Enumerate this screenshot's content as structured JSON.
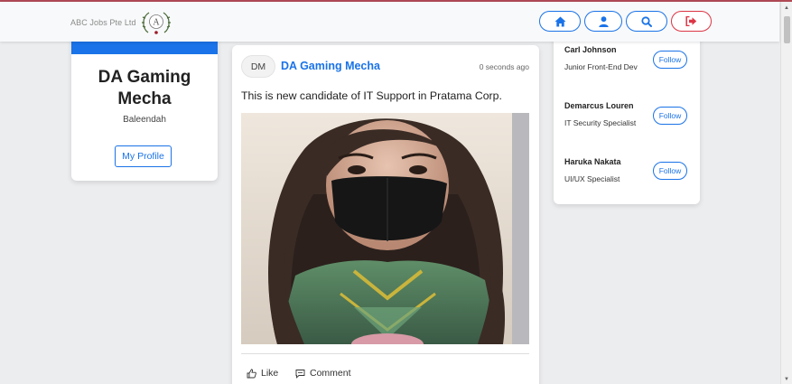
{
  "brand": {
    "name": "ABC Jobs Pte Ltd",
    "logo_letter": "A"
  },
  "nav": [
    {
      "name": "home-icon"
    },
    {
      "name": "user-icon"
    },
    {
      "name": "search-icon"
    },
    {
      "name": "logout-icon"
    }
  ],
  "profile": {
    "name_line1": "DA Gaming",
    "name_line2": "Mecha",
    "location": "Baleendah",
    "button_label": "My Profile"
  },
  "post": {
    "avatar_initials": "DM",
    "author": "DA Gaming Mecha",
    "time": "0 seconds ago",
    "text": "This is new candidate of IT Support in Pratama Corp.",
    "image_icon": "photo-person-mask",
    "like_label": "Like",
    "comment_label": "Comment"
  },
  "suggestions": {
    "follow_label": "Follow",
    "people": [
      {
        "name": "Carl Johnson",
        "title": "Junior Front-End Dev"
      },
      {
        "name": "Demarcus Louren",
        "title": "IT Security Specialist"
      },
      {
        "name": "Haruka Nakata",
        "title": "UI/UX Specialist"
      }
    ]
  },
  "colors": {
    "primary": "#1a73e8",
    "danger": "#dc3545",
    "page_bg": "#ecedef"
  }
}
